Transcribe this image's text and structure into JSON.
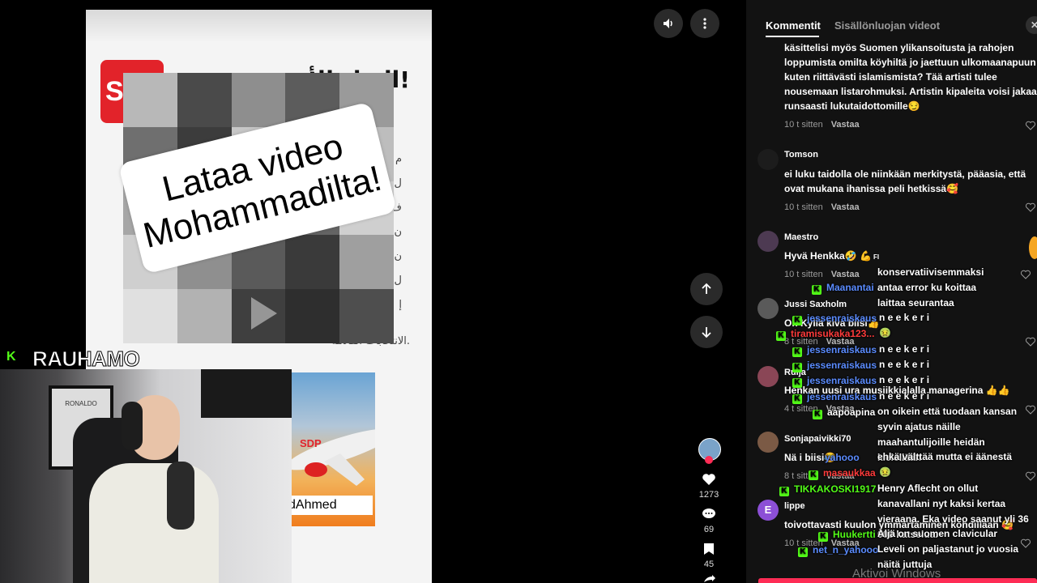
{
  "video": {
    "overlay_line1": "Lataa video",
    "overlay_line2": "Mohammadilta!",
    "logo_letter": "S",
    "arabic_headline": "النداء الأخير!",
    "arabic_line1": "م",
    "arabic_line2": "ل",
    "arabic_line3": "ف",
    "arabic_line4": "ن",
    "arabic_line5": "ن",
    "arabic_line6": "ل",
    "arabic_line7": "إ",
    "arabic_footer": "الانتخابات القادمة.",
    "plane_livery": "SDP",
    "plane_caption": "dAhmed"
  },
  "webcam": {
    "label_a": "RAU",
    "label_b": "HAMO",
    "shirt_text": "RONALDO"
  },
  "actions": {
    "likes": "1273",
    "comments": "69",
    "saves": "45"
  },
  "tabs": {
    "comments": "Kommentit",
    "creator": "Sisällönluojan videot"
  },
  "comments": [
    {
      "user": "",
      "text": "käsittelisi myös Suomen ylikansoitusta ja rahojen loppumista omilta köyhiltä jo jaettuun ulkomaanapuun kuten riittävästi islamismista? Tää artisti tulee nousemaan listarohmuksi. Artistin kipaleita voisi jakaa runsaasti lukutaidottomille😏",
      "time": "10 t sitten",
      "reply": "Vastaa"
    },
    {
      "user": "Tomson",
      "text": "ei luku taidolla ole niinkään merkitystä, pääasia, että ovat mukana ihanissa peli hetkissä🥰",
      "time": "10 t sitten",
      "reply": "Vastaa"
    },
    {
      "user": "Maestro",
      "text": "Hyvä Henkka🤣 💪",
      "time": "10 t sitten",
      "reply": "Vastaa",
      "flag": "FI"
    },
    {
      "user": "Jussi Saxholm",
      "text": "On Kyllä kiva biisi👍",
      "time": "8 t sitten",
      "reply": "Vastaa"
    },
    {
      "user": "Ruija",
      "text": "Henkan uusi ura musiikkialalla managerina 👍👍",
      "time": "4 t sitten",
      "reply": "Vastaa"
    },
    {
      "user": "Sonjapaivikki70",
      "text": "Nä i biisi😂",
      "time": "8 t sitten",
      "reply": "Vastaa"
    },
    {
      "user": "lippe",
      "text": "toivottavasti kuulon ymmärtäminen kohdillaan 🥰",
      "time": "10 t sitten",
      "reply": "Vastaa"
    }
  ],
  "chat": [
    {
      "user": "Maanantai",
      "color": "#5b8cff",
      "msg": "konservatiivisemmaksi antaa error ku koittaa laittaa seurantaa"
    },
    {
      "user": "jessenraiskaus",
      "color": "#5b8cff",
      "msg": "n e e k e r i"
    },
    {
      "user": "tiramisukaka123...",
      "color": "#ff3b3b",
      "msg": "🤢"
    },
    {
      "user": "jessenraiskaus",
      "color": "#5b8cff",
      "msg": "n e e k e r i"
    },
    {
      "user": "jessenraiskaus",
      "color": "#5b8cff",
      "msg": "n e e k e r i"
    },
    {
      "user": "jessenraiskaus",
      "color": "#5b8cff",
      "msg": "n e e k e r i"
    },
    {
      "user": "jessenraiskaus",
      "color": "#5b8cff",
      "msg": "n e e k e r i"
    },
    {
      "user": "aapoapina",
      "color": "#ffffff",
      "msg": "on oikein että tuodaan kansan syvin ajatus näille maahantulijoille heidän kielellään"
    },
    {
      "user": "yahooo",
      "color": "#5b8cff",
      "msg": "ehkä välttää mutta ei äänestä"
    },
    {
      "user": "masaukkaa",
      "color": "#ff3b3b",
      "msg": "🤢"
    },
    {
      "user": "TIKKAKOSKI1917",
      "color": "#53fc18",
      "msg": "Henry Aflecht on ollut kanavallani nyt kaksi kertaa vieraana. Eka video saanut yli 36 000 katselua."
    },
    {
      "user": "Huukertti",
      "color": "#53fc18",
      "msg": "Aljä on suomen clavicular"
    },
    {
      "user": "net_n_yahooo",
      "color": "#5b8cff",
      "msg": "Leveli on paljastanut jo vuosia näitä juttuja"
    }
  ],
  "watermark": "Aktivoi Windows",
  "colors": {
    "accent": "#53fc18",
    "brand_red": "#e2232a",
    "panel_bg": "#121212"
  }
}
